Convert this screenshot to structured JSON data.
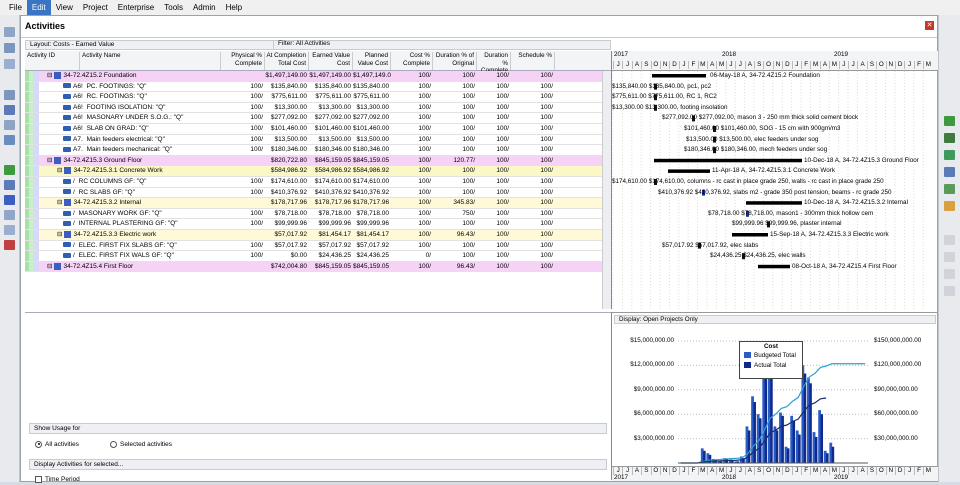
{
  "menu": [
    "File",
    "Edit",
    "View",
    "Project",
    "Enterprise",
    "Tools",
    "Admin",
    "Help"
  ],
  "menu_selected": "Edit",
  "panel_title": "Activities",
  "layout_label": "Layout: Costs - Earned Value",
  "filter_label": "Filter: All Activities",
  "columns": [
    "Activity ID",
    "Activity Name",
    "Physical % Complete",
    "At Completion Total Cost",
    "Earned Value Cost",
    "Planned Value Cost",
    "Cost % Complete",
    "Duration % of Original",
    "Duration % Complete",
    "Schedule %"
  ],
  "rows": [
    {
      "type": "wbs1",
      "id": "34-72.4Z15.2  Foundation",
      "name": "",
      "phys": "",
      "atc": "$1,497,149.00",
      "ev": "$1,497,149.00",
      "pv": "$1,497,149.00",
      "costp": "100/",
      "durorig": "100/",
      "durc": "100/",
      "sched": "100/"
    },
    {
      "type": "act",
      "id": "A6!",
      "name": "PC. FOOTINGS: \"Q\"",
      "phys": "100/",
      "atc": "$135,840.00",
      "ev": "$135,840.00",
      "pv": "$135,840.00",
      "costp": "100/",
      "durorig": "100/",
      "durc": "100/",
      "sched": "100/"
    },
    {
      "type": "act",
      "id": "A6!",
      "name": "RC. FOOTINGS: \"Q\"",
      "phys": "100/",
      "atc": "$775,611.00",
      "ev": "$775,611.00",
      "pv": "$775,611.00",
      "costp": "100/",
      "durorig": "100/",
      "durc": "100/",
      "sched": "100/"
    },
    {
      "type": "act",
      "id": "A6!",
      "name": "FOOTING ISOLATION: \"Q\"",
      "phys": "100/",
      "atc": "$13,300.00",
      "ev": "$13,300.00",
      "pv": "$13,300.00",
      "costp": "100/",
      "durorig": "100/",
      "durc": "100/",
      "sched": "100/"
    },
    {
      "type": "act",
      "id": "A6!",
      "name": "MASONARY UNDER S.O.G.: \"Q\"",
      "phys": "100/",
      "atc": "$277,092.00",
      "ev": "$277,092.00",
      "pv": "$277,092.00",
      "costp": "100/",
      "durorig": "100/",
      "durc": "100/",
      "sched": "100/"
    },
    {
      "type": "act",
      "id": "A6!",
      "name": "SLAB ON GRAD: \"Q\"",
      "phys": "100/",
      "atc": "$101,460.00",
      "ev": "$101,460.00",
      "pv": "$101,460.00",
      "costp": "100/",
      "durorig": "100/",
      "durc": "100/",
      "sched": "100/"
    },
    {
      "type": "act",
      "id": "A7.",
      "name": "Main feeders electrical: \"Q\"",
      "phys": "100/",
      "atc": "$13,500.00",
      "ev": "$13,500.00",
      "pv": "$13,500.00",
      "costp": "100/",
      "durorig": "100/",
      "durc": "100/",
      "sched": "100/"
    },
    {
      "type": "act",
      "id": "A7.",
      "name": "Main feeders mechanical: \"Q\"",
      "phys": "100/",
      "atc": "$180,346.00",
      "ev": "$180,346.00",
      "pv": "$180,346.00",
      "costp": "100/",
      "durorig": "100/",
      "durc": "100/",
      "sched": "100/"
    },
    {
      "type": "wbs1",
      "id": "34-72.4Z15.3  Ground Floor",
      "name": "",
      "phys": "",
      "atc": "$820,722.80",
      "ev": "$845,159.05",
      "pv": "$845,159.05",
      "costp": "100/",
      "durorig": "120.77/",
      "durc": "100/",
      "sched": "100/"
    },
    {
      "type": "wbs2",
      "id": "34-72.4Z15.3.1  Concrete Work",
      "name": "",
      "phys": "",
      "atc": "$584,986.92",
      "ev": "$584,986.92",
      "pv": "$584,986.92",
      "costp": "100/",
      "durorig": "100/",
      "durc": "100/",
      "sched": "100/"
    },
    {
      "type": "act",
      "id": "/",
      "name": "RC COLUMNS GF: \"Q\"",
      "phys": "100/",
      "atc": "$174,610.00",
      "ev": "$174,610.00",
      "pv": "$174,610.00",
      "costp": "100/",
      "durorig": "100/",
      "durc": "100/",
      "sched": "100/"
    },
    {
      "type": "act",
      "id": "/",
      "name": "RC SLABS  GF: \"Q\"",
      "phys": "100/",
      "atc": "$410,376.92",
      "ev": "$410,376.92",
      "pv": "$410,376.92",
      "costp": "100/",
      "durorig": "100/",
      "durc": "100/",
      "sched": "100/"
    },
    {
      "type": "wbs3",
      "id": "34-72.4Z15.3.2  Internal",
      "name": "",
      "phys": "",
      "atc": "$178,717.96",
      "ev": "$178,717.96",
      "pv": "$178,717.96",
      "costp": "100/",
      "durorig": "345.83/",
      "durc": "100/",
      "sched": "100/"
    },
    {
      "type": "act",
      "id": "/",
      "name": "MASONARY WORK  GF: \"Q\"",
      "phys": "100/",
      "atc": "$78,718.00",
      "ev": "$78,718.00",
      "pv": "$78,718.00",
      "costp": "100/",
      "durorig": "750/",
      "durc": "100/",
      "sched": "100/"
    },
    {
      "type": "act",
      "id": "/",
      "name": "INTERNAL PLASTERING  GF: \"Q\"",
      "phys": "100/",
      "atc": "$99,999.96",
      "ev": "$99,999.96",
      "pv": "$99,999.96",
      "costp": "100/",
      "durorig": "100/",
      "durc": "100/",
      "sched": "100/"
    },
    {
      "type": "wbs3",
      "id": "34-72.4Z15.3.3  Electric work",
      "name": "",
      "phys": "",
      "atc": "$57,017.92",
      "ev": "$81,454.17",
      "pv": "$81,454.17",
      "costp": "100/",
      "durorig": "96.43/",
      "durc": "100/",
      "sched": "100/"
    },
    {
      "type": "act",
      "id": "/",
      "name": "ELEC. FIRST FIX  SLABS  GF: \"Q\"",
      "phys": "100/",
      "atc": "$57,017.92",
      "ev": "$57,017.92",
      "pv": "$57,017.92",
      "costp": "100/",
      "durorig": "100/",
      "durc": "100/",
      "sched": "100/"
    },
    {
      "type": "act",
      "id": "/",
      "name": "ELEC. FIRST FIX  WALS  GF: \"Q\"",
      "phys": "100/",
      "atc": "$0.00",
      "ev": "$24,436.25",
      "pv": "$24,436.25",
      "costp": "0/",
      "durorig": "100/",
      "durc": "100/",
      "sched": "100/"
    },
    {
      "type": "wbs1",
      "id": "34-72.4Z15.4  First Floor",
      "name": "",
      "phys": "",
      "atc": "$742,004.80",
      "ev": "$845,159.05",
      "pv": "$845,159.05",
      "costp": "100/",
      "durorig": "96.43/",
      "durc": "100/",
      "sched": "100/"
    }
  ],
  "gantt": {
    "years": [
      "2017",
      "2018",
      "2019"
    ],
    "months": [
      "J",
      "J",
      "A",
      "S",
      "O",
      "N",
      "D",
      "J",
      "F",
      "M",
      "A",
      "M",
      "J",
      "J",
      "A",
      "S",
      "O",
      "N",
      "D",
      "J",
      "F",
      "M",
      "A",
      "M",
      "J",
      "J",
      "A",
      "S",
      "O",
      "N",
      "D",
      "J",
      "F",
      "M"
    ],
    "labels": [
      "06-May-18 A, 34-72.4Z15.2  Foundation",
      "$135,840.00  $135,840.00, pc1, pc2",
      "$775,611.00  $775,611.00, RC 1, RC2",
      "$13,300.00  $13,300.00, footing insolation",
      "$277,092.00  $277,092.00, mason 3 - 250 mm thick solid cement block",
      "$101,460.00  $101,460.00, SOG - 15 cm with 900gm/m3",
      "$13,500.00  $13,500.00, elec feeders under sog",
      "$180,346.00  $180,346.00, mech feeders under sog",
      "10-Dec-18 A, 34-72.4Z15.3  Ground Floor",
      "11-Apr-18 A, 34-72.4Z15.3.1  Concrete Work",
      "$174,610.00  $174,610.00, columns - rc cast in place grade 250, walls - rc cast in place grade 250",
      "$410,376.92  $410,376.92, slabs m2 - grade 350 post tension, beams - rc grade 250",
      "10-Dec-18 A, 34-72.4Z15.3.2  Internal",
      "$78,718.00  $78,718.00, mason1 - 300mm thick hollow cem",
      "$99,999.96  $99,999.96, plaster internal",
      "15-Sep-18 A, 34-72.4Z15.3.3  Electric work",
      "$57,017.92  $57,017.92, elec slabs",
      "$24,436.25  $24,436.25, elec walls",
      "08-Oct-18 A, 34-72.4Z15.4  First Floor"
    ]
  },
  "lower": {
    "show_usage_for": "Show Usage for",
    "opt_all": "All activities",
    "opt_selected": "Selected activities",
    "display_for": "Display Activities for selected...",
    "time_period": "Time Period"
  },
  "histogram": {
    "display_label": "Display: Open Projects Only",
    "legend_title": "Cost",
    "legend_budget": "Budgeted Total",
    "legend_actual": "Actual Total",
    "left_axis": [
      "$15,000,000.00",
      "$12,000,000.00",
      "$9,000,000.00",
      "$6,000,000.00",
      "$3,000,000.00"
    ],
    "right_axis": [
      "$150,000,000.00",
      "$120,000,000.00",
      "$90,000,000.00",
      "$60,000,000.00",
      "$30,000,000.00"
    ],
    "colors": {
      "budget": "#2a5cc8",
      "actual": "#0f2a8a",
      "cum": "#2aa0d8",
      "cum2": "#1a2e6a"
    }
  },
  "chart_data": {
    "type": "bar",
    "title": "Cost",
    "series": [
      {
        "name": "Budgeted Total",
        "values": [
          0,
          0,
          0,
          0,
          1.8,
          1.2,
          0.5,
          0.3,
          0.6,
          0.4,
          0.2,
          0.8,
          4.5,
          8.2,
          6.0,
          11.8,
          12.5,
          4.5,
          6.2,
          2.0,
          5.8,
          4.0,
          12.0,
          10.5,
          3.8,
          6.5,
          1.5,
          2.5,
          0,
          0,
          0,
          0,
          0,
          0
        ]
      },
      {
        "name": "Actual Total",
        "values": [
          0,
          0,
          0,
          0,
          1.5,
          1.0,
          0.4,
          0.2,
          0.5,
          0.3,
          0.2,
          0.6,
          4.0,
          7.5,
          5.5,
          11.0,
          11.8,
          4.0,
          5.8,
          1.8,
          5.2,
          3.5,
          11.0,
          9.8,
          3.2,
          6.0,
          1.2,
          2.0,
          0,
          0,
          0,
          0,
          0,
          0
        ]
      }
    ],
    "ylim": [
      0,
      15000000
    ],
    "y2lim": [
      0,
      150000000
    ]
  }
}
